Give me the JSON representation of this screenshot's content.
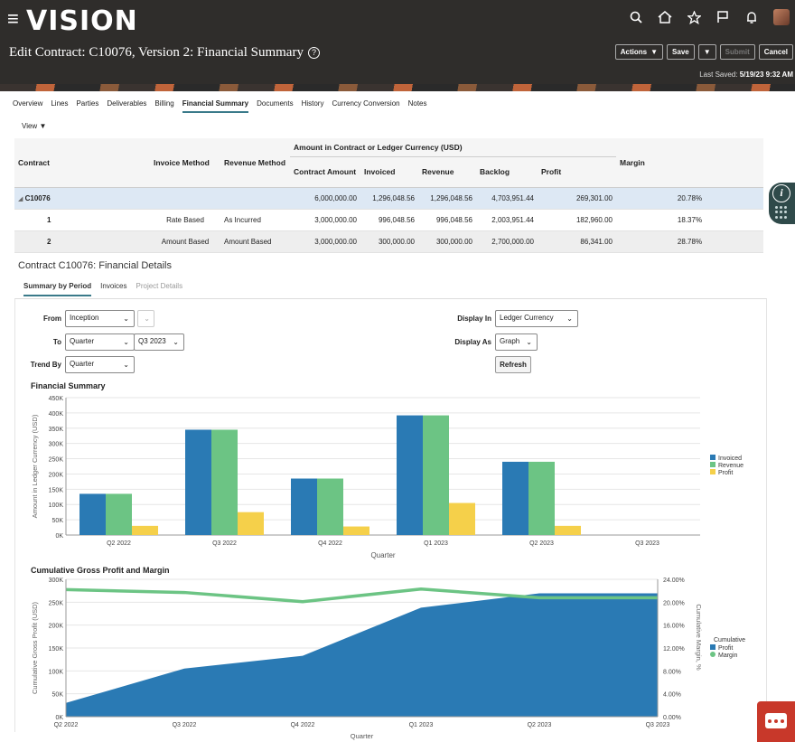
{
  "header": {
    "logo": "VISION",
    "page_title": "Edit Contract: C10076, Version 2: Financial Summary",
    "actions_label": "Actions",
    "save_label": "Save",
    "submit_label": "Submit",
    "cancel_label": "Cancel",
    "last_saved_label": "Last Saved:",
    "last_saved_value": "5/19/23 9:32 AM"
  },
  "nav_tabs": [
    "Overview",
    "Lines",
    "Parties",
    "Deliverables",
    "Billing",
    "Financial Summary",
    "Documents",
    "History",
    "Currency Conversion",
    "Notes"
  ],
  "view_label": "View",
  "grid": {
    "group_header": "Amount in Contract or Ledger Currency (USD)",
    "columns": {
      "contract": "Contract",
      "invoice_method": "Invoice Method",
      "revenue_method": "Revenue Method",
      "contract_amount": "Contract Amount",
      "invoiced": "Invoiced",
      "revenue": "Revenue",
      "backlog": "Backlog",
      "profit": "Profit",
      "margin": "Margin"
    },
    "rows": [
      {
        "contract": "C10076",
        "invoice_method": "",
        "revenue_method": "",
        "contract_amount": "6,000,000.00",
        "invoiced": "1,296,048.56",
        "revenue": "1,296,048.56",
        "backlog": "4,703,951.44",
        "profit": "269,301.00",
        "margin": "20.78%"
      },
      {
        "contract": "1",
        "invoice_method": "Rate Based",
        "revenue_method": "As Incurred",
        "contract_amount": "3,000,000.00",
        "invoiced": "996,048.56",
        "revenue": "996,048.56",
        "backlog": "2,003,951.44",
        "profit": "182,960.00",
        "margin": "18.37%"
      },
      {
        "contract": "2",
        "invoice_method": "Amount Based",
        "revenue_method": "Amount Based",
        "contract_amount": "3,000,000.00",
        "invoiced": "300,000.00",
        "revenue": "300,000.00",
        "backlog": "2,700,000.00",
        "profit": "86,341.00",
        "margin": "28.78%"
      }
    ]
  },
  "details": {
    "title": "Contract C10076: Financial Details",
    "tabs": [
      "Summary by Period",
      "Invoices",
      "Project Details"
    ],
    "from_label": "From",
    "from_value": "Inception",
    "to_label": "To",
    "to_value": "Quarter",
    "to_period": "Q3 2023",
    "trend_label": "Trend By",
    "trend_value": "Quarter",
    "display_in_label": "Display In",
    "display_in_value": "Ledger Currency",
    "display_as_label": "Display As",
    "display_as_value": "Graph",
    "refresh_label": "Refresh"
  },
  "chart_data": [
    {
      "type": "bar",
      "title": "Financial Summary",
      "xlabel": "Quarter",
      "ylabel": "Amount in Ledger Currency (USD)",
      "categories": [
        "Q2 2022",
        "Q3 2022",
        "Q4 2022",
        "Q1 2023",
        "Q2 2023",
        "Q3 2023"
      ],
      "ylim": [
        0,
        450000
      ],
      "yticks": [
        "0K",
        "50K",
        "100K",
        "150K",
        "200K",
        "250K",
        "300K",
        "350K",
        "400K",
        "450K"
      ],
      "legend_position": "right",
      "series": [
        {
          "name": "Invoiced",
          "color": "#2a7ab4",
          "values": [
            135000,
            345000,
            185000,
            392000,
            240000,
            0
          ]
        },
        {
          "name": "Revenue",
          "color": "#6cc484",
          "values": [
            135000,
            345000,
            185000,
            392000,
            240000,
            0
          ]
        },
        {
          "name": "Profit",
          "color": "#f5d04a",
          "values": [
            30000,
            75000,
            28000,
            105000,
            30000,
            0
          ]
        }
      ]
    },
    {
      "type": "area",
      "title": "Cumulative Gross Profit and Margin",
      "xlabel": "Quarter",
      "ylabel": "Cumulative Gross Profit (USD)",
      "y2label": "Cumulative Margin, %",
      "categories": [
        "Q2 2022",
        "Q3 2022",
        "Q4 2022",
        "Q1 2023",
        "Q2 2023",
        "Q3 2023"
      ],
      "ylim": [
        0,
        300000
      ],
      "yticks": [
        "0K",
        "50K",
        "100K",
        "150K",
        "200K",
        "250K",
        "300K"
      ],
      "y2lim": [
        0,
        24
      ],
      "y2ticks": [
        "0.00%",
        "4.00%",
        "8.00%",
        "12.00%",
        "16.00%",
        "20.00%",
        "24.00%"
      ],
      "legend_title": "Cumulative",
      "legend_position": "right",
      "series": [
        {
          "name": "Profit",
          "color": "#2a7ab4",
          "axis": "left",
          "values": [
            30000,
            105000,
            133000,
            238000,
            269301,
            269301
          ]
        },
        {
          "name": "Margin",
          "color": "#6cc484",
          "axis": "right",
          "values": [
            22.2,
            21.7,
            20.1,
            22.3,
            20.78,
            20.78
          ]
        }
      ]
    }
  ]
}
